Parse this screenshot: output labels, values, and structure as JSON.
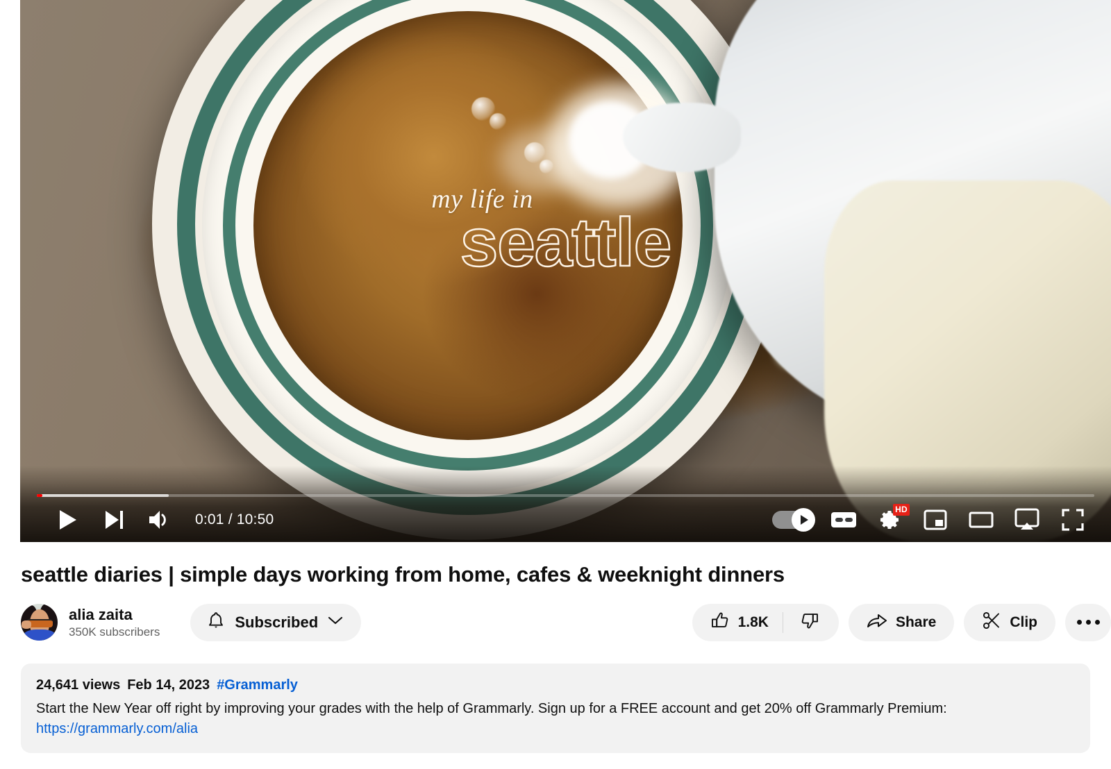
{
  "player": {
    "overlay": {
      "line1": "my life in",
      "line2": "seattle"
    },
    "time_display": "0:01 / 10:50",
    "current_time": "0:01",
    "duration": "10:50",
    "progress_percent": 0.55,
    "buffered_percent": 12.5,
    "progress_color": "#ff0000",
    "controls_left": [
      {
        "name": "play-button",
        "label": "Play"
      },
      {
        "name": "next-button",
        "label": "Next"
      },
      {
        "name": "volume-button",
        "label": "Mute"
      }
    ],
    "controls_right": [
      {
        "name": "autoplay-toggle",
        "label": "Autoplay",
        "state": "on"
      },
      {
        "name": "captions-button",
        "label": "Subtitles/closed captions (c)"
      },
      {
        "name": "settings-button",
        "label": "Settings",
        "badge": "HD"
      },
      {
        "name": "miniplayer-button",
        "label": "Miniplayer (i)"
      },
      {
        "name": "theater-button",
        "label": "Theater mode (t)"
      },
      {
        "name": "cast-button",
        "label": "Play on TV"
      },
      {
        "name": "fullscreen-button",
        "label": "Full screen (f)"
      }
    ],
    "hd_badge": "HD"
  },
  "video": {
    "title": "seattle diaries | simple days working from home, cafes & weeknight dinners"
  },
  "owner": {
    "channel_name": "alia zaita",
    "subscriber_count": "350K subscribers",
    "subscribe_label": "Subscribed",
    "avatar_alt": "alia zaita channel avatar"
  },
  "actions": {
    "like_count": "1.8K",
    "like_label": "like this video along with 1.8K other people",
    "dislike_label": "Dislike this video",
    "share_label": "Share",
    "clip_label": "Clip",
    "more_label": "More actions"
  },
  "description": {
    "views": "24,641 views",
    "date": "Feb 14, 2023",
    "hashtag": "#Grammarly",
    "body_before_link": "Start the New Year off right by improving your grades with the help of Grammarly. Sign up for a FREE account and get 20% off Grammarly Premium: ",
    "link_text": "https://grammarly.com/alia"
  },
  "colors": {
    "accent_red": "#ff0000",
    "link_blue": "#065fd4",
    "chip_gray": "#f2f2f2",
    "text_primary": "#0f0f0f",
    "text_secondary": "#606060"
  }
}
